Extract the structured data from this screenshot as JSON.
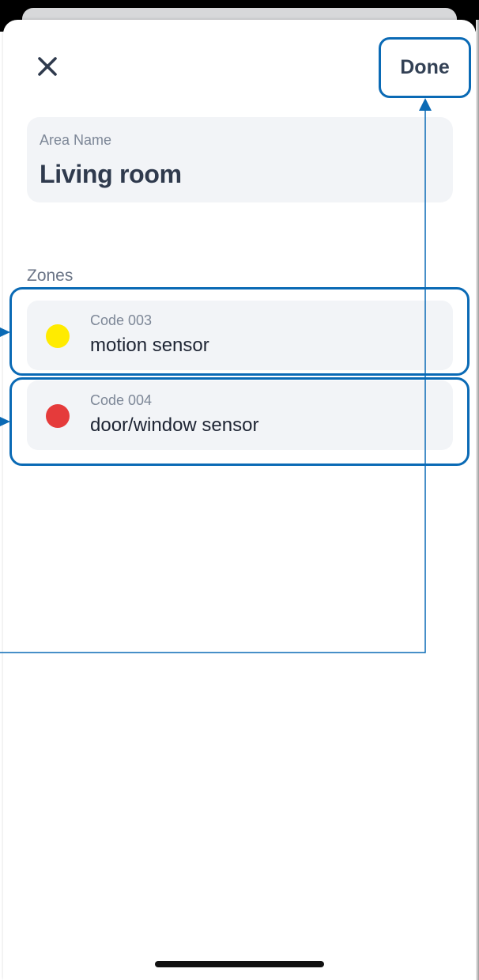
{
  "header": {
    "close_icon": "close-icon",
    "done_label": "Done"
  },
  "area": {
    "label": "Area Name",
    "value": "Living room"
  },
  "zones": {
    "label": "Zones",
    "items": [
      {
        "code": "Code 003",
        "name": "motion sensor",
        "dot_color": "#FFEB00"
      },
      {
        "code": "Code 004",
        "name": "door/window sensor",
        "dot_color": "#E53B3B"
      }
    ]
  },
  "colors": {
    "annotation": "#0A6AB5",
    "text_dark": "#2F3A4D",
    "card_bg": "#F2F4F7"
  }
}
